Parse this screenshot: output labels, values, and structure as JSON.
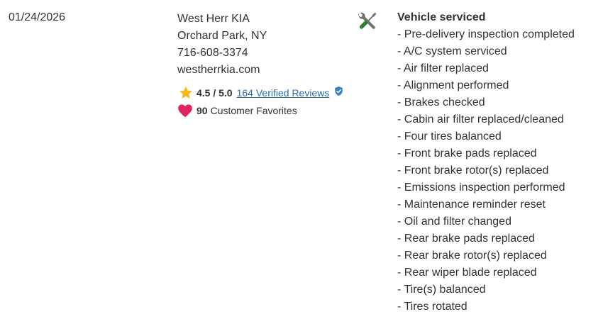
{
  "record": {
    "date": "01/24/2026"
  },
  "dealer": {
    "name": "West Herr KIA",
    "location": "Orchard Park, NY",
    "phone": "716-608-3374",
    "website": "westherrkia.com",
    "rating": "4.5 / 5.0",
    "reviews_link": "164 Verified Reviews",
    "favorites_count": "90",
    "favorites_label": "Customer Favorites"
  },
  "icons": {
    "star": "star-icon",
    "verified": "verified-badge-icon",
    "heart": "heart-icon",
    "service_tools": "wrench-screwdriver-icon"
  },
  "colors": {
    "star": "#f6b81a",
    "heart": "#e0245e",
    "link": "#2b6cb0",
    "verified": "#3b82c4",
    "tools_gray": "#707070",
    "tools_green": "#2e7d32"
  },
  "service": {
    "heading": "Vehicle serviced",
    "items": [
      "- Pre-delivery inspection completed",
      "- A/C system serviced",
      "- Air filter replaced",
      "- Alignment performed",
      "- Brakes checked",
      "- Cabin air filter replaced/cleaned",
      "- Four tires balanced",
      "- Front brake pads replaced",
      "- Front brake rotor(s) replaced",
      "- Emissions inspection performed",
      "- Maintenance reminder reset",
      "- Oil and filter changed",
      "- Rear brake pads replaced",
      "- Rear brake rotor(s) replaced",
      "- Rear wiper blade replaced",
      "- Tire(s) balanced",
      "- Tires rotated"
    ]
  }
}
